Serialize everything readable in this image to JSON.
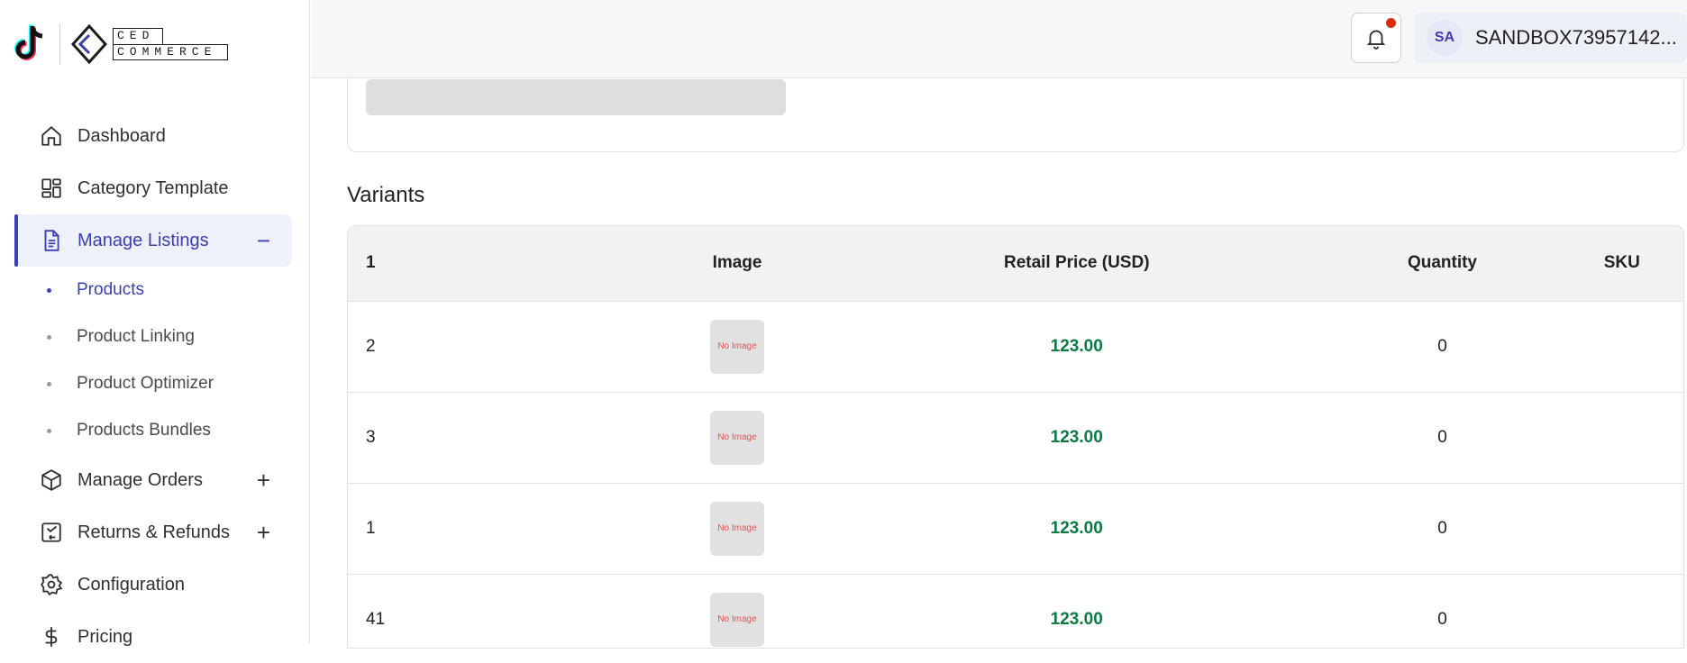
{
  "brand": {
    "ced_line1": "CED",
    "ced_line2": "COMMERCE"
  },
  "sidebar": {
    "items": [
      {
        "label": "Dashboard",
        "icon": "home-icon"
      },
      {
        "label": "Category Template",
        "icon": "grid-icon"
      },
      {
        "label": "Manage Listings",
        "icon": "document-icon",
        "toggle": "−",
        "active": true
      },
      {
        "label": "Manage Orders",
        "icon": "box-icon",
        "toggle": "+"
      },
      {
        "label": "Returns & Refunds",
        "icon": "returns-icon",
        "toggle": "+"
      },
      {
        "label": "Configuration",
        "icon": "gear-icon"
      },
      {
        "label": "Pricing",
        "icon": "dollar-icon"
      }
    ],
    "sub_items": [
      {
        "label": "Products",
        "active": true
      },
      {
        "label": "Product Linking"
      },
      {
        "label": "Product Optimizer"
      },
      {
        "label": "Products Bundles"
      }
    ]
  },
  "header": {
    "avatar_initials": "SA",
    "account_name": "SANDBOX73957142..."
  },
  "main": {
    "section_title": "Variants",
    "table": {
      "headers": [
        "1",
        "Image",
        "Retail Price (USD)",
        "Quantity",
        "SKU"
      ],
      "no_image_text": "No Image",
      "rows": [
        {
          "variant": "2",
          "price": "123.00",
          "quantity": "0",
          "sku": ""
        },
        {
          "variant": "3",
          "price": "123.00",
          "quantity": "0",
          "sku": ""
        },
        {
          "variant": "1",
          "price": "123.00",
          "quantity": "0",
          "sku": ""
        },
        {
          "variant": "41",
          "price": "123.00",
          "quantity": "0",
          "sku": ""
        }
      ]
    }
  },
  "colors": {
    "accent": "#3b3fb0",
    "price": "#0b7a45",
    "badge": "#d72c0d"
  }
}
